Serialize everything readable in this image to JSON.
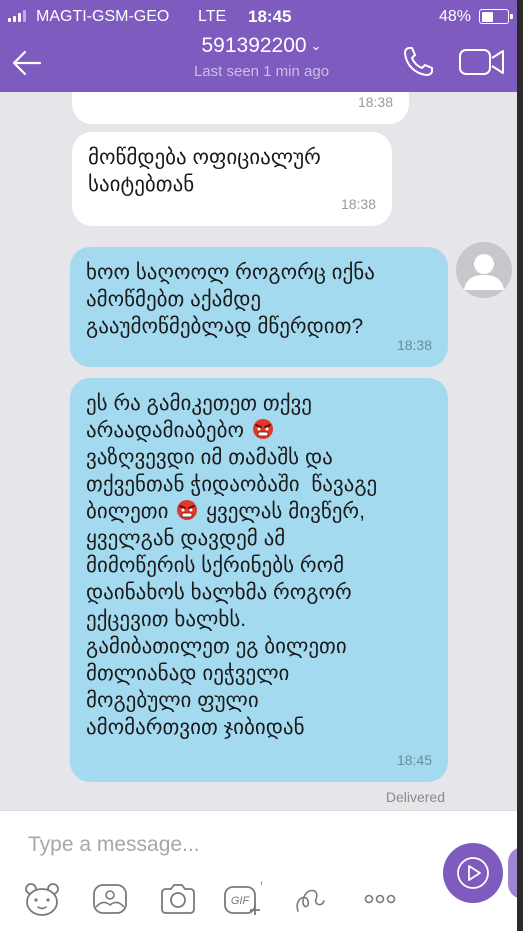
{
  "status_bar": {
    "carrier": "MAGTI-GSM-GEO",
    "network": "LTE",
    "time": "18:45",
    "battery": "48%",
    "battery_level": 0.48
  },
  "header": {
    "contact": "591392200",
    "last_seen": "Last seen 1 min ago",
    "icons": [
      "back-arrow-icon",
      "chevron-down-icon",
      "phone-icon",
      "video-camera-icon"
    ]
  },
  "messages": [
    {
      "direction": "incoming",
      "text": "",
      "time": "18:38"
    },
    {
      "direction": "incoming",
      "text": "მოწმდება ოფიციალურ\nსაიტებთან",
      "time": "18:38"
    },
    {
      "direction": "outgoing",
      "text": "ხოო საღოოლ როგორც იქნა\nამოწმებთ აქამდე\nგააუმოწმებლად მწერდით?",
      "time": "18:38"
    },
    {
      "direction": "outgoing",
      "parts": [
        "ეს რა გამიკეთეთ თქვე\nარაადამიაბებო ",
        "\nვაზღვევდი იმ თამაშს და\nთქვენთან ჭიდაობაში  წავაგე\nბილეთი ",
        " ყველას მივწერ,\nყველგან დავდემ ამ\nმიმოწერის სქრინებს რომ\nდაინახოს ხალხმა როგორ\nექცევით ხალხს.\nგამიბათილეთ ეგ ბილეთი\nმთლიანად იეჭველი\nმოგებული ფული\nამომართვით ჯიბიდან"
      ],
      "emoji": "angry-face-emoji",
      "time": "18:45"
    }
  ],
  "delivery_status": "Delivered",
  "composer": {
    "placeholder": "Type a message...",
    "tools": [
      "sticker-bear-icon",
      "image-gallery-icon",
      "camera-icon",
      "gif-plus-icon",
      "doodle-icon",
      "more-icon"
    ],
    "voice_button": "voice-message-icon"
  },
  "colors": {
    "header": "#7e5bbf",
    "chat_background": "#e6e6ea",
    "incoming_bubble": "#ffffff",
    "outgoing_bubble": "#a4daf0"
  }
}
